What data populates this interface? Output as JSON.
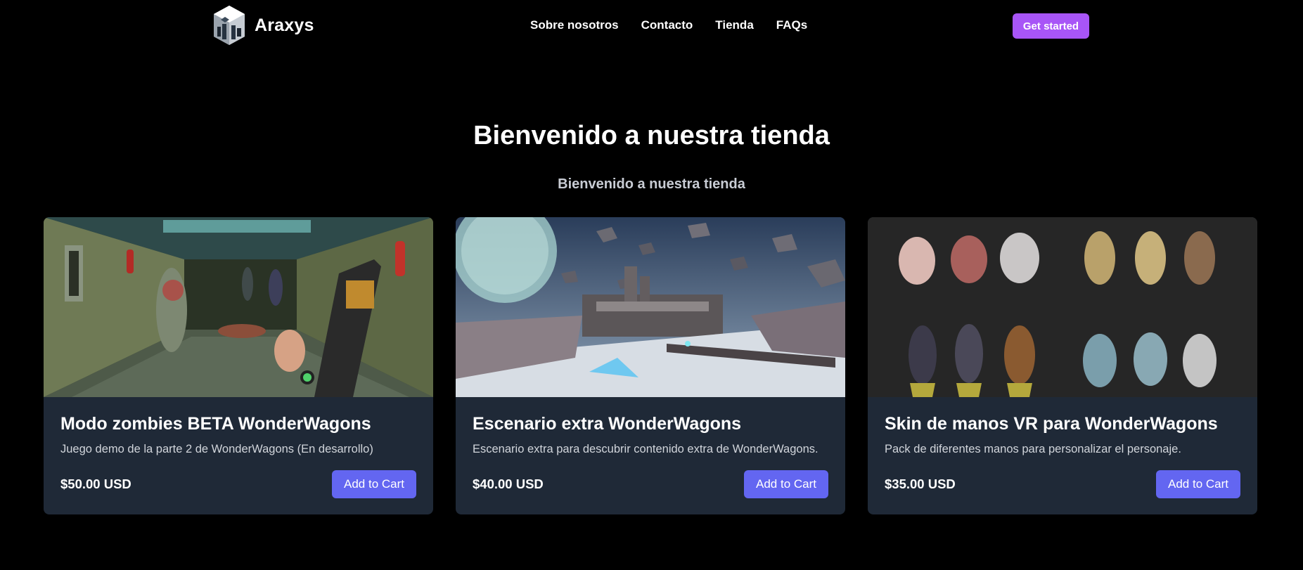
{
  "brand": {
    "name": "Araxys",
    "logo_icon": "cube-city-logo-icon"
  },
  "nav": {
    "links": [
      "Sobre nosotros",
      "Contacto",
      "Tienda",
      "FAQs"
    ],
    "cta_label": "Get started"
  },
  "hero": {
    "title": "Bienvenido a nuestra tienda",
    "subtitle": "Bienvenido a nuestra tienda"
  },
  "colors": {
    "background": "#000000",
    "card": "#1f2937",
    "cta": "#a855f7",
    "button": "#6366f1"
  },
  "products": [
    {
      "title": "Modo zombies BETA WonderWagons",
      "description": "Juego demo de la parte 2 de WonderWagons (En desarrollo)",
      "price": "$50.00 USD",
      "button_label": "Add to Cart",
      "image": "zombie-corridor-image"
    },
    {
      "title": "Escenario extra WonderWagons",
      "description": "Escenario extra para descubrir contenido extra de WonderWagons.",
      "price": "$40.00 USD",
      "button_label": "Add to Cart",
      "image": "lowpoly-moon-base-image"
    },
    {
      "title": "Skin de manos VR para WonderWagons",
      "description": "Pack de diferentes manos para personalizar el personaje.",
      "price": "$35.00 USD",
      "button_label": "Add to Cart",
      "image": "vr-hands-grid-image"
    }
  ]
}
